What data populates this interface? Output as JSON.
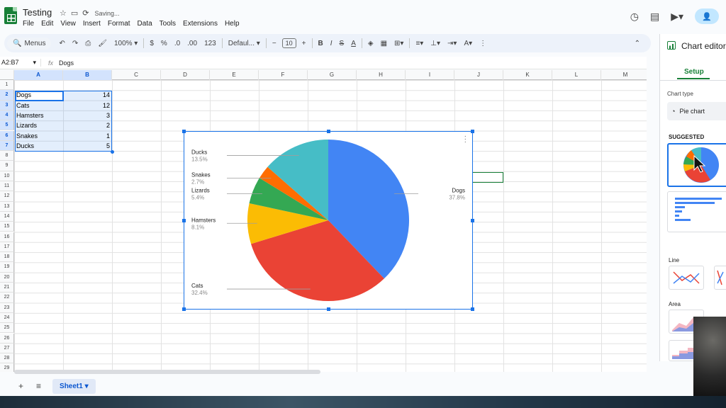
{
  "app": {
    "title": "Testing",
    "saving_status": "Saving...",
    "menu": [
      "File",
      "Edit",
      "View",
      "Insert",
      "Format",
      "Data",
      "Tools",
      "Extensions",
      "Help"
    ]
  },
  "toolbar": {
    "search_label": "Menus",
    "zoom": "100%",
    "currency": "$",
    "percent": "%",
    "dec_decrease": ".0",
    "dec_increase": ".00",
    "format_123": "123",
    "font": "Defaul...",
    "font_size": "10"
  },
  "formula_bar": {
    "name_box": "A2:B7",
    "fx": "fx",
    "value": "Dogs"
  },
  "columns": [
    "A",
    "B",
    "C",
    "D",
    "E",
    "F",
    "G",
    "H",
    "I",
    "J",
    "K",
    "L",
    "M"
  ],
  "rows": [
    "1",
    "2",
    "3",
    "4",
    "5",
    "6",
    "7",
    "8",
    "9",
    "10",
    "11",
    "12",
    "13",
    "14",
    "15",
    "16",
    "17",
    "18",
    "19",
    "20",
    "21",
    "22",
    "23",
    "24",
    "25",
    "26",
    "27",
    "28",
    "29"
  ],
  "cells": [
    {
      "label": "Dogs",
      "value": "14"
    },
    {
      "label": "Cats",
      "value": "12"
    },
    {
      "label": "Hamsters",
      "value": "3"
    },
    {
      "label": "Lizards",
      "value": "2"
    },
    {
      "label": "Snakes",
      "value": "1"
    },
    {
      "label": "Ducks",
      "value": "5"
    }
  ],
  "chart_data": {
    "type": "pie",
    "categories": [
      "Dogs",
      "Cats",
      "Hamsters",
      "Lizards",
      "Snakes",
      "Ducks"
    ],
    "values": [
      14,
      12,
      3,
      2,
      1,
      5
    ],
    "percent_labels": [
      "37.8%",
      "32.4%",
      "8.1%",
      "5.4%",
      "2.7%",
      "13.5%"
    ],
    "colors": [
      "#4285f4",
      "#ea4335",
      "#fbbc04",
      "#34a853",
      "#ff6d01",
      "#46bdc6"
    ],
    "legend": "labeled"
  },
  "sheet_tabs": [
    "Sheet1"
  ],
  "chart_editor": {
    "title": "Chart editor",
    "tab_setup": "Setup",
    "chart_type_label": "Chart type",
    "chart_type_value": "Pie chart",
    "suggested_label": "SUGGESTED",
    "line_label": "Line",
    "area_label": "Area"
  }
}
